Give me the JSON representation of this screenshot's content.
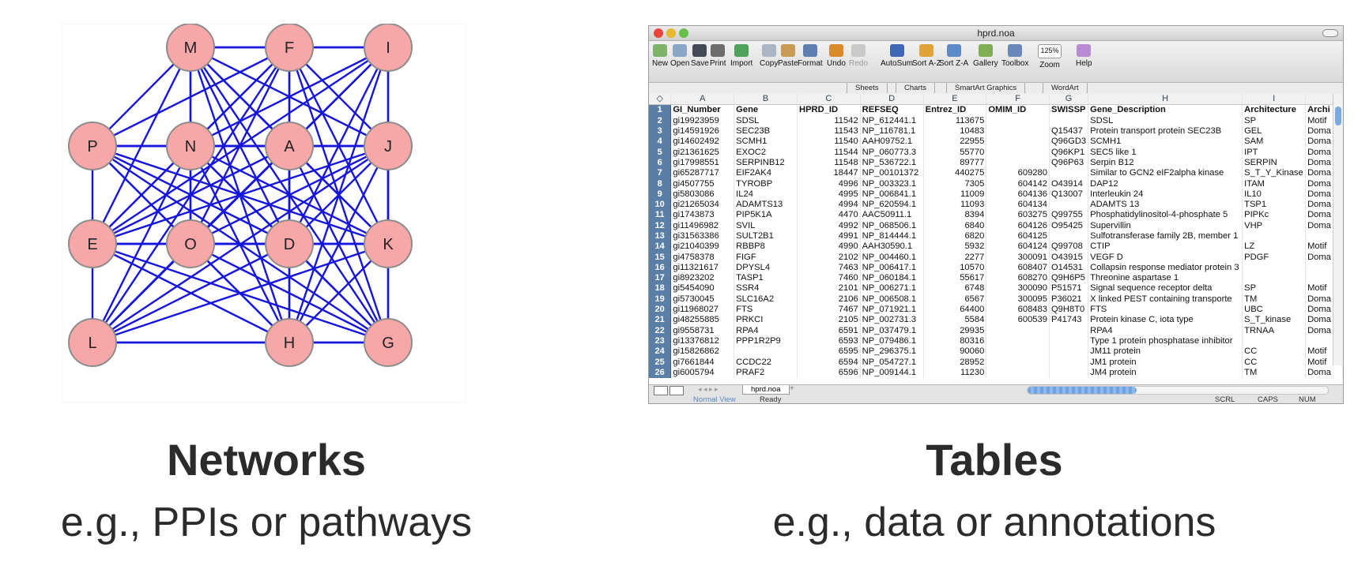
{
  "network": {
    "nodes": [
      {
        "id": "M"
      },
      {
        "id": "F"
      },
      {
        "id": "I"
      },
      {
        "id": "P"
      },
      {
        "id": "N"
      },
      {
        "id": "A"
      },
      {
        "id": "J"
      },
      {
        "id": "E"
      },
      {
        "id": "O"
      },
      {
        "id": "D"
      },
      {
        "id": "K"
      },
      {
        "id": "L"
      },
      {
        "id": "H"
      },
      {
        "id": "G"
      }
    ],
    "edges": [
      [
        "M",
        "F"
      ],
      [
        "F",
        "I"
      ],
      [
        "M",
        "I"
      ],
      [
        "P",
        "N"
      ],
      [
        "N",
        "A"
      ],
      [
        "A",
        "J"
      ],
      [
        "P",
        "E"
      ],
      [
        "E",
        "L"
      ],
      [
        "L",
        "H"
      ],
      [
        "H",
        "G"
      ],
      [
        "J",
        "K"
      ],
      [
        "K",
        "G"
      ],
      [
        "E",
        "O"
      ],
      [
        "O",
        "D"
      ],
      [
        "D",
        "K"
      ],
      [
        "M",
        "N"
      ],
      [
        "F",
        "A"
      ],
      [
        "I",
        "J"
      ],
      [
        "N",
        "O"
      ],
      [
        "A",
        "D"
      ],
      [
        "M",
        "P"
      ],
      [
        "M",
        "A"
      ],
      [
        "M",
        "J"
      ],
      [
        "M",
        "E"
      ],
      [
        "M",
        "O"
      ],
      [
        "M",
        "D"
      ],
      [
        "M",
        "K"
      ],
      [
        "M",
        "H"
      ],
      [
        "M",
        "G"
      ],
      [
        "F",
        "N"
      ],
      [
        "F",
        "P"
      ],
      [
        "F",
        "J"
      ],
      [
        "F",
        "E"
      ],
      [
        "F",
        "O"
      ],
      [
        "F",
        "D"
      ],
      [
        "F",
        "K"
      ],
      [
        "F",
        "L"
      ],
      [
        "F",
        "G"
      ],
      [
        "I",
        "A"
      ],
      [
        "I",
        "N"
      ],
      [
        "I",
        "D"
      ],
      [
        "I",
        "O"
      ],
      [
        "I",
        "E"
      ],
      [
        "I",
        "L"
      ],
      [
        "I",
        "K"
      ],
      [
        "I",
        "H"
      ],
      [
        "P",
        "A"
      ],
      [
        "P",
        "O"
      ],
      [
        "P",
        "D"
      ],
      [
        "P",
        "H"
      ],
      [
        "P",
        "K"
      ],
      [
        "P",
        "G"
      ],
      [
        "N",
        "E"
      ],
      [
        "N",
        "D"
      ],
      [
        "N",
        "K"
      ],
      [
        "N",
        "J"
      ],
      [
        "N",
        "L"
      ],
      [
        "N",
        "H"
      ],
      [
        "N",
        "G"
      ],
      [
        "A",
        "E"
      ],
      [
        "A",
        "O"
      ],
      [
        "A",
        "K"
      ],
      [
        "A",
        "L"
      ],
      [
        "A",
        "H"
      ],
      [
        "A",
        "G"
      ],
      [
        "J",
        "D"
      ],
      [
        "J",
        "O"
      ],
      [
        "J",
        "E"
      ],
      [
        "J",
        "L"
      ],
      [
        "J",
        "H"
      ],
      [
        "J",
        "G"
      ],
      [
        "E",
        "D"
      ],
      [
        "E",
        "H"
      ],
      [
        "E",
        "G"
      ],
      [
        "O",
        "L"
      ],
      [
        "O",
        "H"
      ],
      [
        "O",
        "G"
      ],
      [
        "O",
        "K"
      ],
      [
        "D",
        "L"
      ],
      [
        "D",
        "H"
      ],
      [
        "D",
        "G"
      ],
      [
        "K",
        "H"
      ],
      [
        "K",
        "L"
      ],
      [
        "L",
        "G"
      ],
      [
        "E",
        "K"
      ],
      [
        "P",
        "J"
      ]
    ],
    "node_fill": "#f7a7a7",
    "node_stroke": "#8c8c8c",
    "edge_color": "#1515dd"
  },
  "captions": {
    "networks_title": "Networks",
    "networks_sub": "e.g., PPIs or pathways",
    "tables_title": "Tables",
    "tables_sub": "e.g., data or annotations"
  },
  "spreadsheet": {
    "window_title": "hprd.noa",
    "toolbar": [
      {
        "label": "New",
        "icon": "new-document-icon",
        "color": "#7fb36a"
      },
      {
        "label": "Open",
        "icon": "open-folder-icon",
        "color": "#8aa7c8"
      },
      {
        "label": "Save",
        "icon": "save-disk-icon",
        "color": "#444a55"
      },
      {
        "label": "Print",
        "icon": "printer-icon",
        "color": "#6d6d6d"
      },
      {
        "label": "Import",
        "icon": "import-icon",
        "color": "#4ea25a"
      },
      {
        "label": "Copy",
        "icon": "copy-icon",
        "color": "#a9b6c6"
      },
      {
        "label": "Paste",
        "icon": "paste-icon",
        "color": "#c99b55"
      },
      {
        "label": "Format",
        "icon": "format-brush-icon",
        "color": "#5e7fb0"
      },
      {
        "label": "Undo",
        "icon": "undo-icon",
        "color": "#d98b2b"
      },
      {
        "label": "Redo",
        "icon": "redo-icon",
        "color": "#c9c9c9",
        "disabled": true
      },
      {
        "label": "AutoSum",
        "icon": "autosum-icon",
        "color": "#3e67b5"
      },
      {
        "label": "Sort A-Z",
        "icon": "sort-az-icon",
        "color": "#e0a33a"
      },
      {
        "label": "Sort Z-A",
        "icon": "sort-za-icon",
        "color": "#5b8bc7"
      },
      {
        "label": "Gallery",
        "icon": "gallery-icon",
        "color": "#7fae55"
      },
      {
        "label": "Toolbox",
        "icon": "toolbox-icon",
        "color": "#6b86b8"
      },
      {
        "label": "Zoom",
        "icon": "zoom-icon",
        "color": "#ffffff",
        "value": "125%"
      },
      {
        "label": "Help",
        "icon": "help-icon",
        "color": "#b98bd6"
      }
    ],
    "ribbon_tabs": [
      "Sheets",
      "Charts",
      "SmartArt Graphics",
      "WordArt"
    ],
    "col_letters": [
      "A",
      "B",
      "C",
      "D",
      "E",
      "F",
      "G",
      "H",
      "I",
      ""
    ],
    "headers": [
      "GI_Number",
      "Gene",
      "HPRD_ID",
      "REFSEQ",
      "Entrez_ID",
      "OMIM_ID",
      "SWISSP",
      "Gene_Description",
      "Architecture",
      "Archi"
    ],
    "rows": [
      [
        "gi19923959",
        "SDSL",
        "11542",
        "NP_612441.1",
        "113675",
        "",
        "",
        "SDSL",
        "SP",
        "Motif"
      ],
      [
        "gi14591926",
        "SEC23B",
        "11543",
        "NP_116781.1",
        "10483",
        "",
        "Q15437",
        "Protein transport protein SEC23B",
        "GEL",
        "Doma"
      ],
      [
        "gi14602492",
        "SCMH1",
        "11540",
        "AAH09752.1",
        "22955",
        "",
        "Q96GD3",
        "SCMH1",
        "SAM",
        "Doma"
      ],
      [
        "gi21361625",
        "EXOC2",
        "11544",
        "NP_060773.3",
        "55770",
        "",
        "Q96KP1",
        "SEC5 like 1",
        "IPT",
        "Doma"
      ],
      [
        "gi17998551",
        "SERPINB12",
        "11548",
        "NP_536722.1",
        "89777",
        "",
        "Q96P63",
        "Serpin B12",
        "SERPIN",
        "Doma"
      ],
      [
        "gi65287717",
        "EIF2AK4",
        "18447",
        "NP_00101372",
        "440275",
        "609280",
        "",
        "Similar to GCN2 eIF2alpha kinase",
        "S_T_Y_Kinase",
        "Doma"
      ],
      [
        "gi4507755",
        "TYROBP",
        "4996",
        "NP_003323.1",
        "7305",
        "604142",
        "O43914",
        "DAP12",
        "ITAM",
        "Doma"
      ],
      [
        "gi5803086",
        "IL24",
        "4995",
        "NP_006841.1",
        "11009",
        "604136",
        "Q13007",
        "Interleukin 24",
        "IL10",
        "Doma"
      ],
      [
        "gi21265034",
        "ADAMTS13",
        "4994",
        "NP_620594.1",
        "11093",
        "604134",
        "",
        "ADAMTS 13",
        "TSP1",
        "Doma"
      ],
      [
        "gi1743873",
        "PIP5K1A",
        "4470",
        "AAC50911.1",
        "8394",
        "603275",
        "Q99755",
        "Phosphatidylinositol-4-phosphate 5",
        "PIPKc",
        "Doma"
      ],
      [
        "gi11496982",
        "SVIL",
        "4992",
        "NP_068506.1",
        "6840",
        "604126",
        "O95425",
        "Supervillin",
        "VHP",
        "Doma"
      ],
      [
        "gi31563386",
        "SULT2B1",
        "4991",
        "NP_814444.1",
        "6820",
        "604125",
        "",
        "Sulfotransferase family 2B, member 1",
        "",
        ""
      ],
      [
        "gi21040399",
        "RBBP8",
        "4990",
        "AAH30590.1",
        "5932",
        "604124",
        "Q99708",
        "CTIP",
        "LZ",
        "Motif"
      ],
      [
        "gi4758378",
        "FIGF",
        "2102",
        "NP_004460.1",
        "2277",
        "300091",
        "O43915",
        "VEGF D",
        "PDGF",
        "Doma"
      ],
      [
        "gi11321617",
        "DPYSL4",
        "7463",
        "NP_006417.1",
        "10570",
        "608407",
        "O14531",
        "Collapsin response mediator protein 3",
        "",
        ""
      ],
      [
        "gi8923202",
        "TASP1",
        "7460",
        "NP_060184.1",
        "55617",
        "608270",
        "Q9H6P5",
        "Threonine aspartase 1",
        "",
        ""
      ],
      [
        "gi5454090",
        "SSR4",
        "2101",
        "NP_006271.1",
        "6748",
        "300090",
        "P51571",
        "Signal sequence receptor delta",
        "SP",
        "Motif"
      ],
      [
        "gi5730045",
        "SLC16A2",
        "2106",
        "NP_006508.1",
        "6567",
        "300095",
        "P36021",
        "X linked PEST containing transporte",
        "TM",
        "Doma"
      ],
      [
        "gi11968027",
        "FTS",
        "7467",
        "NP_071921.1",
        "64400",
        "608483",
        "Q9H8T0",
        "FTS",
        "UBC",
        "Doma"
      ],
      [
        "gi48255885",
        "PRKCI",
        "2105",
        "NP_002731.3",
        "5584",
        "600539",
        "P41743",
        "Protein kinase C, iota type",
        "S_T_kinase",
        "Doma"
      ],
      [
        "gi9558731",
        "RPA4",
        "6591",
        "NP_037479.1",
        "29935",
        "",
        "",
        "RPA4",
        "TRNAA",
        "Doma"
      ],
      [
        "gi13376812",
        "PPP1R2P9",
        "6593",
        "NP_079486.1",
        "80316",
        "",
        "",
        "Type 1 protein phosphatase inhibitor",
        "",
        ""
      ],
      [
        "gi15826862",
        "",
        "6595",
        "NP_296375.1",
        "90060",
        "",
        "",
        "JM11 protein",
        "CC",
        "Motif"
      ],
      [
        "gi7661844",
        "CCDC22",
        "6594",
        "NP_054727.1",
        "28952",
        "",
        "",
        "JM1 protein",
        "CC",
        "Motif"
      ],
      [
        "gi6005794",
        "PRAF2",
        "6596",
        "NP_009144.1",
        "11230",
        "",
        "",
        "JM4 protein",
        "TM",
        "Doma"
      ]
    ],
    "sheet_tab": "hprd.noa",
    "status_view": "Normal View",
    "status_ready": "Ready",
    "status_scrl": "SCRL",
    "status_caps": "CAPS",
    "status_num": "NUM"
  }
}
